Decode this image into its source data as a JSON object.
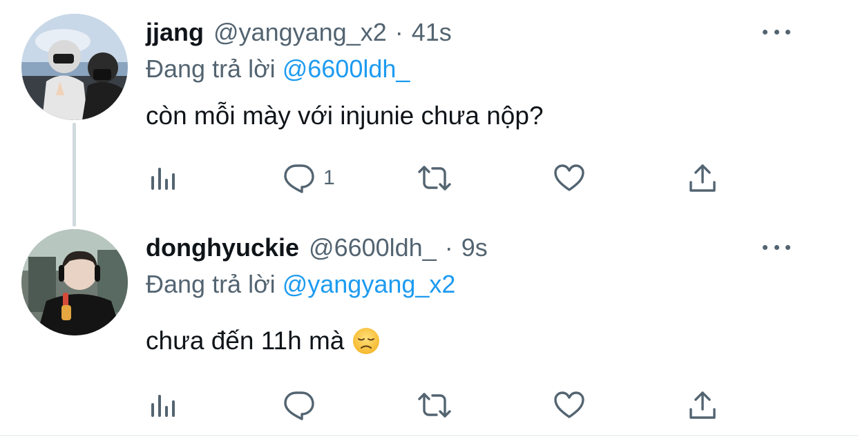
{
  "tweets": [
    {
      "display_name": "jjang",
      "handle": "@yangyang_x2",
      "separator": "·",
      "time": "41s",
      "reply_prefix": "Đang trả lời",
      "reply_to": "@6600ldh_",
      "text": "còn mỗi mày với injunie chưa nộp?",
      "reply_count": "1"
    },
    {
      "display_name": "donghyuckie",
      "handle": "@6600ldh_",
      "separator": "·",
      "time": "9s",
      "reply_prefix": "Đang trả lời",
      "reply_to": "@yangyang_x2",
      "text": "chưa đến 11h mà",
      "emoji": "disappointed-face-emoji",
      "reply_count": ""
    }
  ],
  "icons": {
    "views": "views-chart-icon",
    "reply": "reply-bubble-icon",
    "retweet": "retweet-icon",
    "like": "heart-icon",
    "share": "share-upload-icon",
    "more": "more-dots-icon"
  },
  "colors": {
    "text_primary": "#0f1419",
    "text_secondary": "#536471",
    "link": "#1d9bf0",
    "thread_line": "#cfd9de",
    "divider": "#eff3f4"
  }
}
